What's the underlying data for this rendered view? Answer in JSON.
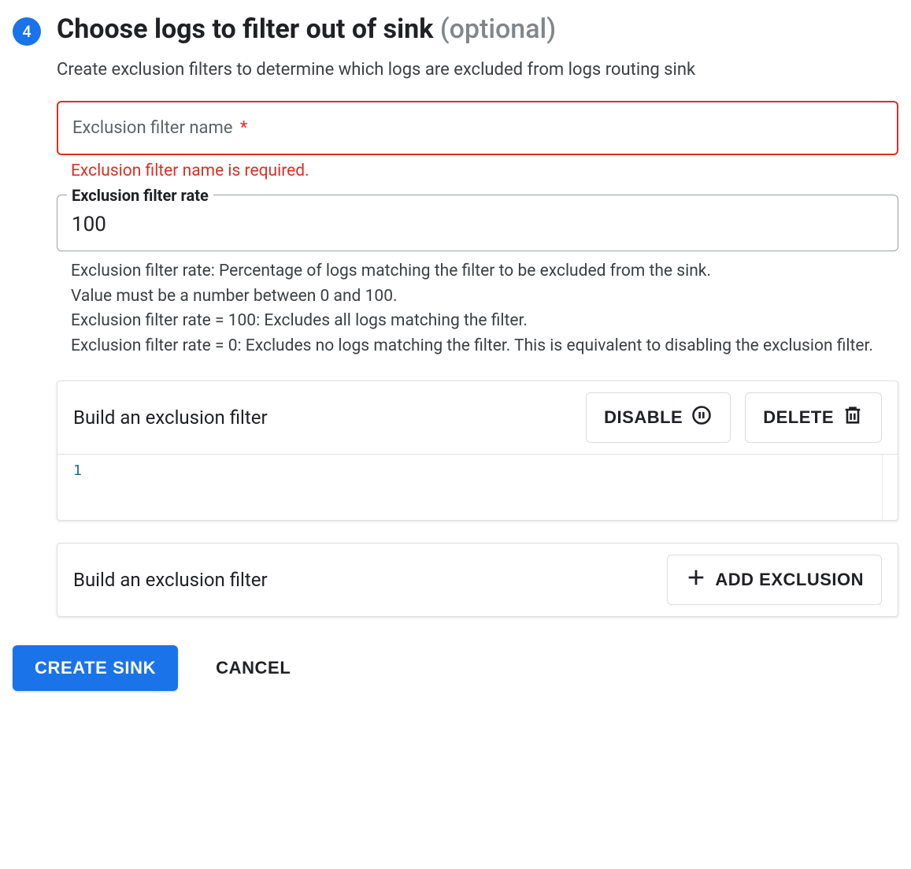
{
  "step": {
    "number": "4",
    "title": "Choose logs to filter out of sink",
    "optional": "(optional)",
    "description": "Create exclusion filters to determine which logs are excluded from logs routing sink"
  },
  "nameField": {
    "label": "Exclusion filter name",
    "requiredMark": "*",
    "error": "Exclusion filter name is required."
  },
  "rateField": {
    "label": "Exclusion filter rate",
    "value": "100",
    "help": "Exclusion filter rate: Percentage of logs matching the filter to be excluded from the sink.\nValue must be a number between 0 and 100.\nExclusion filter rate = 100: Excludes all logs matching the filter.\nExclusion filter rate = 0: Excludes no logs matching the filter. This is equivalent to disabling the exclusion filter."
  },
  "filterCard": {
    "title": "Build an exclusion filter",
    "disable": "DISABLE",
    "delete": "DELETE",
    "lineNumber": "1"
  },
  "addCard": {
    "title": "Build an exclusion filter",
    "addLabel": "ADD EXCLUSION"
  },
  "footer": {
    "create": "CREATE SINK",
    "cancel": "CANCEL"
  }
}
